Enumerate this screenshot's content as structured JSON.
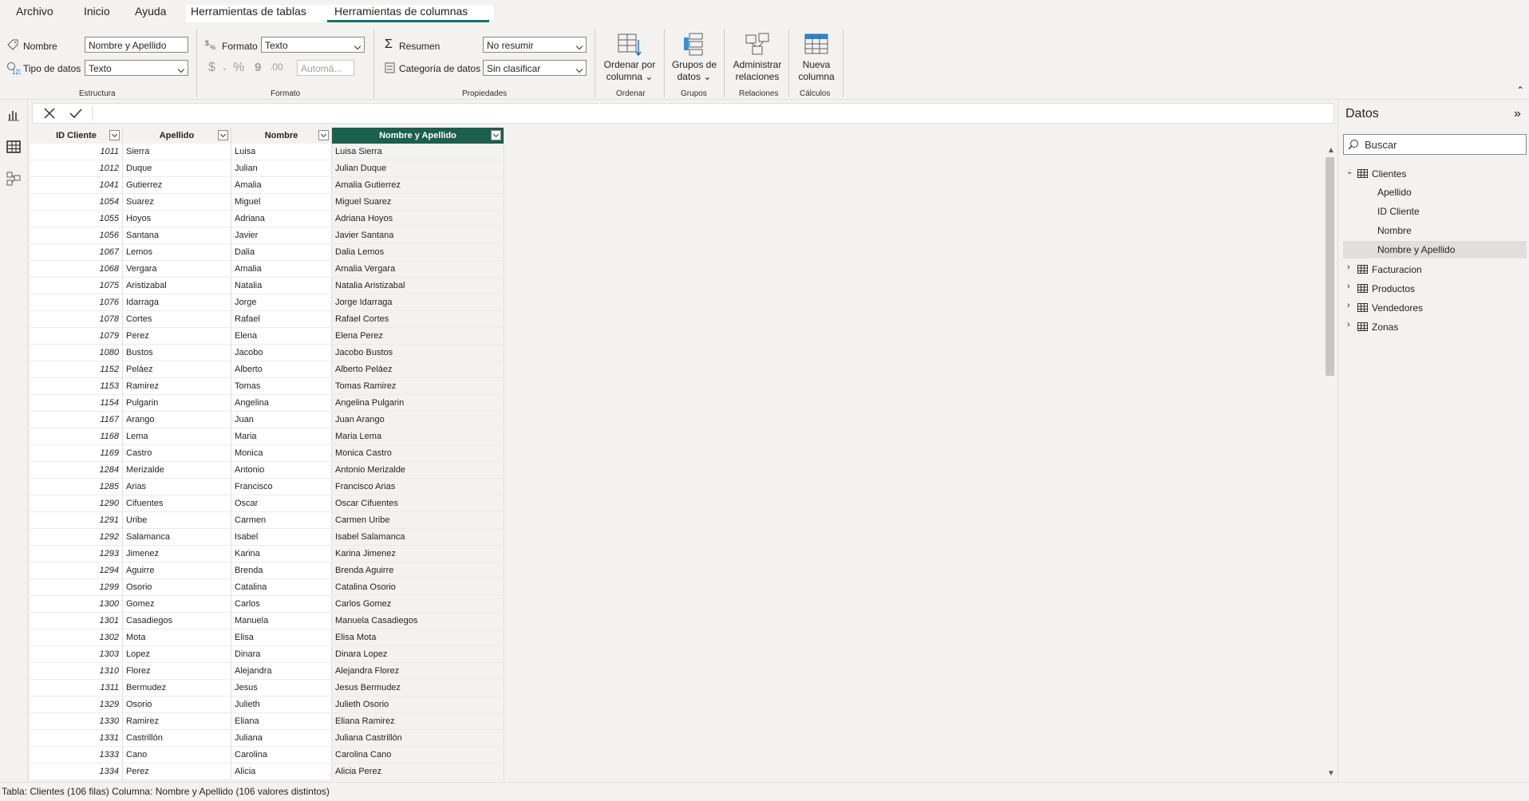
{
  "menu": {
    "tabs": [
      "Archivo",
      "Inicio",
      "Ayuda",
      "Herramientas de tablas",
      "Herramientas de columnas"
    ],
    "active": "Herramientas de columnas"
  },
  "ribbon": {
    "estructura": {
      "nombre_label": "Nombre",
      "nombre_value": "Nombre y Apellido",
      "tipo_label": "Tipo de datos",
      "tipo_value": "Texto",
      "group": "Estructura"
    },
    "formato": {
      "formato_label": "Formato",
      "formato_value": "Texto",
      "currency": "$",
      "percent": "%",
      "comma": "9",
      "decimals": ".00",
      "auto_value": "Automá...",
      "group": "Formato"
    },
    "propiedades": {
      "resumen_label": "Resumen",
      "resumen_value": "No resumir",
      "categoria_label": "Categoría de datos",
      "categoria_value": "Sin clasificar",
      "group": "Propiedades"
    },
    "ordenar": {
      "line1": "Ordenar por",
      "line2": "columna",
      "group": "Ordenar"
    },
    "grupos": {
      "line1": "Grupos de",
      "line2": "datos",
      "group": "Grupos"
    },
    "relaciones": {
      "line1": "Administrar",
      "line2": "relaciones",
      "group": "Relaciones"
    },
    "calculos": {
      "line1": "Nueva",
      "line2": "columna",
      "group": "Cálculos"
    }
  },
  "table": {
    "columns": [
      "ID Cliente",
      "Apellido",
      "Nombre",
      "Nombre y Apellido"
    ],
    "rows": [
      [
        "1011",
        "Sierra",
        "Luisa",
        "Luisa Sierra"
      ],
      [
        "1012",
        "Duque",
        "Julian",
        "Julian Duque"
      ],
      [
        "1041",
        "Gutierrez",
        "Amalia",
        "Amalia Gutierrez"
      ],
      [
        "1054",
        "Suarez",
        "Miguel",
        "Miguel Suarez"
      ],
      [
        "1055",
        "Hoyos",
        "Adriana",
        "Adriana Hoyos"
      ],
      [
        "1056",
        "Santana",
        "Javier",
        "Javier Santana"
      ],
      [
        "1067",
        "Lemos",
        "Dalia",
        "Dalia Lemos"
      ],
      [
        "1068",
        "Vergara",
        "Amalia",
        "Amalia Vergara"
      ],
      [
        "1075",
        "Aristizabal",
        "Natalia",
        "Natalia Aristizabal"
      ],
      [
        "1076",
        "Idarraga",
        "Jorge",
        "Jorge Idarraga"
      ],
      [
        "1078",
        "Cortes",
        "Rafael",
        "Rafael Cortes"
      ],
      [
        "1079",
        "Perez",
        "Elena",
        "Elena Perez"
      ],
      [
        "1080",
        "Bustos",
        "Jacobo",
        "Jacobo Bustos"
      ],
      [
        "1152",
        "Peláez",
        "Alberto",
        "Alberto Peláez"
      ],
      [
        "1153",
        "Ramirez",
        "Tomas",
        "Tomas Ramirez"
      ],
      [
        "1154",
        "Pulgarin",
        "Angelina",
        "Angelina Pulgarin"
      ],
      [
        "1167",
        "Arango",
        "Juan",
        "Juan Arango"
      ],
      [
        "1168",
        "Lema",
        "Maria",
        "Maria Lema"
      ],
      [
        "1169",
        "Castro",
        "Monica",
        "Monica Castro"
      ],
      [
        "1284",
        "Merizalde",
        "Antonio",
        "Antonio Merizalde"
      ],
      [
        "1285",
        "Arias",
        "Francisco",
        "Francisco Arias"
      ],
      [
        "1290",
        "Cifuentes",
        "Oscar",
        "Oscar Cifuentes"
      ],
      [
        "1291",
        "Uribe",
        "Carmen",
        "Carmen Uribe"
      ],
      [
        "1292",
        "Salamanca",
        "Isabel",
        "Isabel Salamanca"
      ],
      [
        "1293",
        "Jimenez",
        "Karina",
        "Karina Jimenez"
      ],
      [
        "1294",
        "Aguirre",
        "Brenda",
        "Brenda Aguirre"
      ],
      [
        "1299",
        "Osorio",
        "Catalina",
        "Catalina Osorio"
      ],
      [
        "1300",
        "Gomez",
        "Carlos",
        "Carlos Gomez"
      ],
      [
        "1301",
        "Casadiegos",
        "Manuela",
        "Manuela Casadiegos"
      ],
      [
        "1302",
        "Mota",
        "Elisa",
        "Elisa Mota"
      ],
      [
        "1303",
        "Lopez",
        "Dinara",
        "Dinara Lopez"
      ],
      [
        "1310",
        "Florez",
        "Alejandra",
        "Alejandra Florez"
      ],
      [
        "1311",
        "Bermudez",
        "Jesus",
        "Jesus Bermudez"
      ],
      [
        "1329",
        "Osorio",
        "Julieth",
        "Julieth Osorio"
      ],
      [
        "1330",
        "Ramirez",
        "Eliana",
        "Eliana Ramirez"
      ],
      [
        "1331",
        "Castrillón",
        "Juliana",
        "Juliana Castrillón"
      ],
      [
        "1333",
        "Cano",
        "Carolina",
        "Carolina Cano"
      ],
      [
        "1334",
        "Perez",
        "Alicia",
        "Alicia Perez"
      ]
    ]
  },
  "pane": {
    "title": "Datos",
    "search_placeholder": "Buscar",
    "tables": [
      {
        "name": "Clientes",
        "expanded": true,
        "fields": [
          "Apellido",
          "ID Cliente",
          "Nombre",
          "Nombre y Apellido"
        ],
        "selected_field": "Nombre y Apellido"
      },
      {
        "name": "Facturacion",
        "expanded": false
      },
      {
        "name": "Productos",
        "expanded": false
      },
      {
        "name": "Vendedores",
        "expanded": false
      },
      {
        "name": "Zonas",
        "expanded": false
      }
    ]
  },
  "status": "Tabla: Clientes (106 filas) Columna: Nombre y Apellido (106 valores distintos)",
  "colors": {
    "accent": "#117865",
    "selected_header": "#1b5f4d"
  }
}
